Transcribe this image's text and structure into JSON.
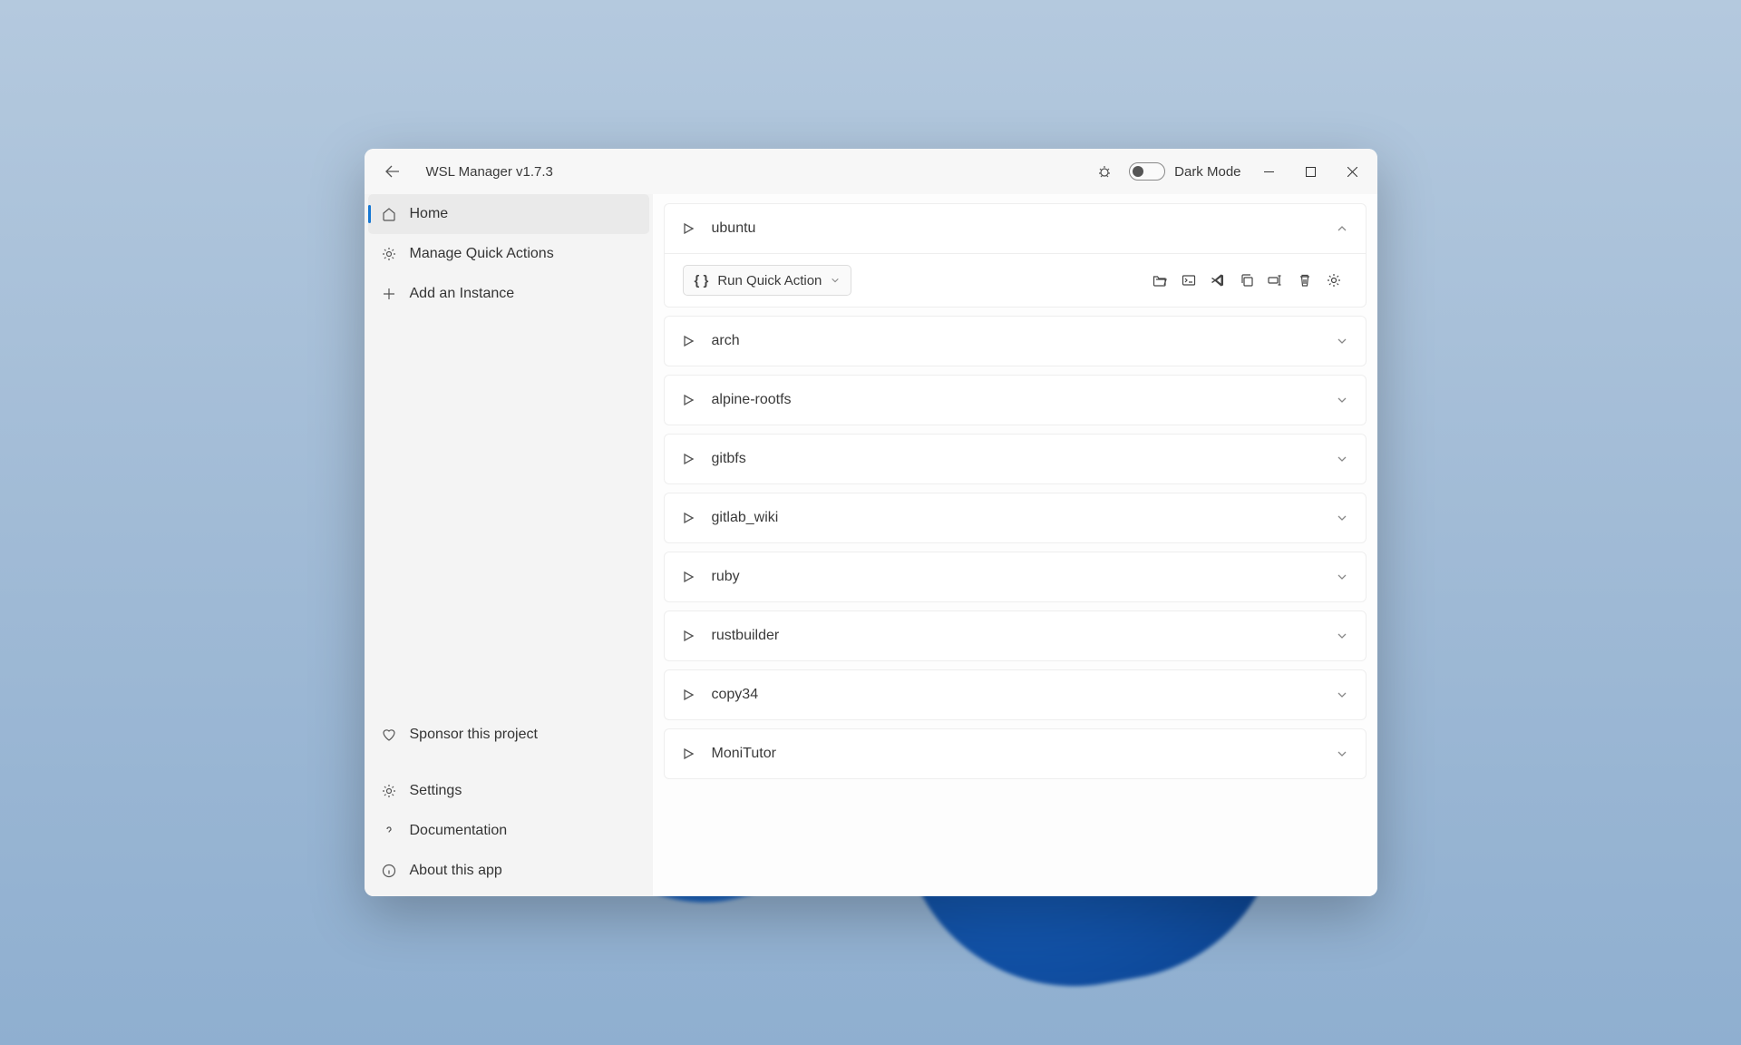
{
  "titlebar": {
    "title": "WSL Manager v1.7.3",
    "dark_mode_label": "Dark Mode"
  },
  "sidebar": {
    "top": [
      {
        "label": "Home"
      },
      {
        "label": "Manage Quick Actions"
      },
      {
        "label": "Add an Instance"
      }
    ],
    "bottom": [
      {
        "label": "Sponsor this project"
      },
      {
        "label": "Settings"
      },
      {
        "label": "Documentation"
      },
      {
        "label": "About this app"
      }
    ]
  },
  "quick_action": {
    "label": "Run Quick Action"
  },
  "instances": [
    {
      "name": "ubuntu",
      "expanded": true
    },
    {
      "name": "arch",
      "expanded": false
    },
    {
      "name": "alpine-rootfs",
      "expanded": false
    },
    {
      "name": "gitbfs",
      "expanded": false
    },
    {
      "name": "gitlab_wiki",
      "expanded": false
    },
    {
      "name": "ruby",
      "expanded": false
    },
    {
      "name": "rustbuilder",
      "expanded": false
    },
    {
      "name": "copy34",
      "expanded": false
    },
    {
      "name": "MoniTutor",
      "expanded": false
    }
  ]
}
